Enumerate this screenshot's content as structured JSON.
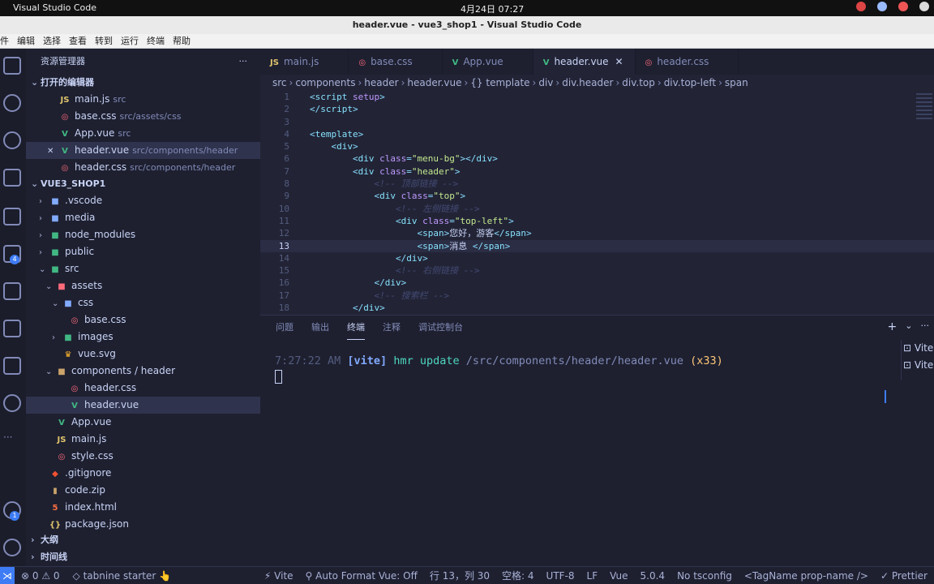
{
  "system": {
    "app_name": "Visual Studio Code",
    "clock": "4月24日  07:27"
  },
  "window": {
    "title": "header.vue - vue3_shop1 - Visual Studio Code"
  },
  "menu": [
    "件",
    "编辑",
    "选择",
    "查看",
    "转到",
    "运行",
    "终端",
    "帮助"
  ],
  "sidebar": {
    "title": "资源管理器",
    "more": "···",
    "open_editors_title": "打开的编辑器",
    "open_editors": [
      {
        "icon": "JS",
        "type": "js",
        "name": "main.js",
        "desc": "src"
      },
      {
        "icon": "◎",
        "type": "css",
        "name": "base.css",
        "desc": "src/assets/css"
      },
      {
        "icon": "V",
        "type": "vue",
        "name": "App.vue",
        "desc": "src"
      },
      {
        "icon": "V",
        "type": "vue",
        "name": "header.vue",
        "desc": "src/components/header",
        "close": "✕"
      },
      {
        "icon": "◎",
        "type": "css",
        "name": "header.css",
        "desc": "src/components/header"
      }
    ],
    "project_title": "VUE3_SHOP1",
    "tree": [
      {
        "twisty": "›",
        "icon": "■",
        "type": "folder",
        "name": ".vscode"
      },
      {
        "twisty": "›",
        "icon": "■",
        "type": "folder",
        "name": "media"
      },
      {
        "twisty": "›",
        "icon": "■",
        "type": "vue",
        "name": "node_modules"
      },
      {
        "twisty": "›",
        "icon": "■",
        "type": "vue",
        "name": "public"
      },
      {
        "twisty": "⌄",
        "icon": "■",
        "type": "vue",
        "name": "src"
      },
      {
        "twisty": "⌄",
        "icon": "■",
        "type": "css",
        "name": "assets"
      },
      {
        "twisty": "⌄",
        "icon": "■",
        "type": "folder",
        "name": "css"
      },
      {
        "twisty": "",
        "icon": "◎",
        "type": "css",
        "name": "base.css"
      },
      {
        "twisty": "›",
        "icon": "■",
        "type": "vue",
        "name": "images"
      },
      {
        "twisty": "",
        "icon": "♛",
        "type": "svg",
        "name": "vue.svg"
      },
      {
        "twisty": "⌄",
        "icon": "■",
        "type": "zip",
        "name": "components / header"
      },
      {
        "twisty": "",
        "icon": "◎",
        "type": "css",
        "name": "header.css"
      },
      {
        "twisty": "",
        "icon": "V",
        "type": "vue",
        "name": "header.vue"
      },
      {
        "twisty": "",
        "icon": "V",
        "type": "vue",
        "name": "App.vue"
      },
      {
        "twisty": "",
        "icon": "JS",
        "type": "js",
        "name": "main.js"
      },
      {
        "twisty": "",
        "icon": "◎",
        "type": "css",
        "name": "style.css"
      },
      {
        "twisty": "",
        "icon": "◆",
        "type": "git",
        "name": ".gitignore"
      },
      {
        "twisty": "",
        "icon": "▮",
        "type": "zip",
        "name": "code.zip"
      },
      {
        "twisty": "",
        "icon": "5",
        "type": "html",
        "name": "index.html"
      },
      {
        "twisty": "",
        "icon": "{}",
        "type": "js",
        "name": "package.json"
      }
    ],
    "outline_title": "大纲",
    "timeline_title": "时间线"
  },
  "tabs": [
    {
      "icon": "JS",
      "type": "js",
      "name": "main.js"
    },
    {
      "icon": "◎",
      "type": "css",
      "name": "base.css"
    },
    {
      "icon": "V",
      "type": "vue",
      "name": "App.vue"
    },
    {
      "icon": "V",
      "type": "vue",
      "name": "header.vue",
      "active": true,
      "close": "✕"
    },
    {
      "icon": "◎",
      "type": "css",
      "name": "header.css"
    }
  ],
  "breadcrumb": [
    "src",
    "components",
    "header",
    "header.vue",
    "{} template",
    "div",
    "div.header",
    "div.top",
    "div.top-left",
    "span"
  ],
  "code": [
    {
      "n": "1",
      "indent": "",
      "segs": [
        [
          "t-p",
          "<"
        ],
        [
          "t-tag",
          "script"
        ],
        [
          "t-attr",
          " setup"
        ],
        [
          "t-p",
          ">"
        ]
      ]
    },
    {
      "n": "2",
      "indent": "",
      "segs": [
        [
          "t-p",
          "</"
        ],
        [
          "t-tag",
          "script"
        ],
        [
          "t-p",
          ">"
        ]
      ]
    },
    {
      "n": "3",
      "indent": "",
      "segs": []
    },
    {
      "n": "4",
      "indent": "",
      "segs": [
        [
          "t-p",
          "<"
        ],
        [
          "t-tag",
          "template"
        ],
        [
          "t-p",
          ">"
        ]
      ]
    },
    {
      "n": "5",
      "indent": "    ",
      "segs": [
        [
          "t-p",
          "<"
        ],
        [
          "t-tag",
          "div"
        ],
        [
          "t-p",
          ">"
        ]
      ]
    },
    {
      "n": "6",
      "indent": "        ",
      "segs": [
        [
          "t-p",
          "<"
        ],
        [
          "t-tag",
          "div"
        ],
        [
          "t-attr",
          " class"
        ],
        [
          "t-p",
          "="
        ],
        [
          "t-str",
          "\"menu-bg\""
        ],
        [
          "t-p",
          "></"
        ],
        [
          "t-tag",
          "div"
        ],
        [
          "t-p",
          ">"
        ]
      ]
    },
    {
      "n": "7",
      "indent": "        ",
      "segs": [
        [
          "t-p",
          "<"
        ],
        [
          "t-tag",
          "div"
        ],
        [
          "t-attr",
          " class"
        ],
        [
          "t-p",
          "="
        ],
        [
          "t-str",
          "\"header\""
        ],
        [
          "t-p",
          ">"
        ]
      ]
    },
    {
      "n": "8",
      "indent": "            ",
      "segs": [
        [
          "t-com",
          "<!-- 顶部链接 -->"
        ]
      ]
    },
    {
      "n": "9",
      "indent": "            ",
      "segs": [
        [
          "t-p",
          "<"
        ],
        [
          "t-tag",
          "div"
        ],
        [
          "t-attr",
          " class"
        ],
        [
          "t-p",
          "="
        ],
        [
          "t-str",
          "\"top\""
        ],
        [
          "t-p",
          ">"
        ]
      ]
    },
    {
      "n": "10",
      "indent": "                ",
      "segs": [
        [
          "t-com",
          "<!-- 左侧链接 -->"
        ]
      ]
    },
    {
      "n": "11",
      "indent": "                ",
      "segs": [
        [
          "t-p",
          "<"
        ],
        [
          "t-tag",
          "div"
        ],
        [
          "t-attr",
          " class"
        ],
        [
          "t-p",
          "="
        ],
        [
          "t-str",
          "\"top-left\""
        ],
        [
          "t-p",
          ">"
        ]
      ]
    },
    {
      "n": "12",
      "indent": "                    ",
      "segs": [
        [
          "t-p",
          "<"
        ],
        [
          "t-tag",
          "span"
        ],
        [
          "t-p",
          ">"
        ],
        [
          "t-txt",
          "您好，游客"
        ],
        [
          "t-p",
          "</"
        ],
        [
          "t-tag",
          "span"
        ],
        [
          "t-p",
          ">"
        ]
      ]
    },
    {
      "n": "13",
      "indent": "                    ",
      "segs": [
        [
          "t-p",
          "<"
        ],
        [
          "t-tag",
          "span"
        ],
        [
          "t-p",
          ">"
        ],
        [
          "t-txt",
          "消息 "
        ],
        [
          "t-p",
          "</"
        ],
        [
          "t-tag",
          "span"
        ],
        [
          "t-p",
          ">"
        ]
      ],
      "current": true
    },
    {
      "n": "14",
      "indent": "                ",
      "segs": [
        [
          "t-p",
          "</"
        ],
        [
          "t-tag",
          "div"
        ],
        [
          "t-p",
          ">"
        ]
      ]
    },
    {
      "n": "15",
      "indent": "                ",
      "segs": [
        [
          "t-com",
          "<!-- 右侧链接 -->"
        ]
      ]
    },
    {
      "n": "16",
      "indent": "            ",
      "segs": [
        [
          "t-p",
          "</"
        ],
        [
          "t-tag",
          "div"
        ],
        [
          "t-p",
          ">"
        ]
      ]
    },
    {
      "n": "17",
      "indent": "            ",
      "segs": [
        [
          "t-com",
          "<!-- 搜索栏 -->"
        ]
      ]
    },
    {
      "n": "18",
      "indent": "        ",
      "segs": [
        [
          "t-p",
          "</"
        ],
        [
          "t-tag",
          "div"
        ],
        [
          "t-p",
          ">"
        ]
      ]
    }
  ],
  "panel": {
    "tabs": [
      "问题",
      "输出",
      "终端",
      "注释",
      "调试控制台"
    ],
    "active_tab": "终端",
    "actions": [
      "+",
      "⌄",
      "···"
    ],
    "terminal": {
      "time": "7:27:22 AM",
      "tag": "[vite]",
      "msg": "hmr update",
      "path": "/src/components/header/header.vue",
      "count": "(x33)"
    },
    "terminal_list": [
      "Vite",
      "Vite"
    ]
  },
  "status": {
    "remote": "⋊",
    "left": [
      "⊗ 0  ⚠ 0",
      "◇ tabnine starter 👆"
    ],
    "right": [
      "⚡ Vite",
      "⚲ Auto Format Vue: Off",
      "行 13，列 30",
      "空格: 4",
      "UTF-8",
      "LF",
      "Vue",
      "5.0.4",
      "No tsconfig",
      "<TagName prop-name />",
      "✓ Prettier"
    ]
  },
  "activity": {
    "badges": [
      "4",
      "1"
    ]
  }
}
